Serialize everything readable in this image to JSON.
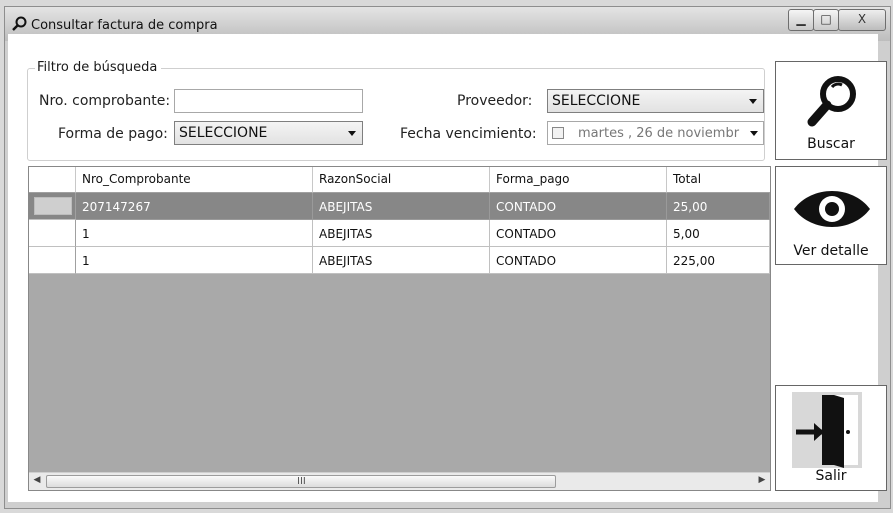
{
  "window": {
    "title": "Consultar factura de compra",
    "controls": {
      "minimize": "▁",
      "maximize": "□",
      "close": "X"
    }
  },
  "filter": {
    "legend": "Filtro de búsqueda",
    "nro_comprobante_label": "Nro. comprobante:",
    "nro_comprobante_value": "",
    "proveedor_label": "Proveedor:",
    "proveedor_value": "SELECCIONE",
    "forma_pago_label": "Forma de pago:",
    "forma_pago_value": "SELECCIONE",
    "fecha_vencimiento_label": "Fecha vencimiento:",
    "fecha_vencimiento_value": "martes   , 26 de noviembr"
  },
  "buttons": {
    "buscar": "Buscar",
    "ver_detalle": "Ver detalle",
    "salir": "Salir"
  },
  "grid": {
    "columns": [
      "Nro_Comprobante",
      "RazonSocial",
      "Forma_pago",
      "Total"
    ],
    "rows": [
      {
        "nro": "207147267",
        "razon": "ABEJITAS",
        "forma": "CONTADO",
        "total": "25,00",
        "selected": true
      },
      {
        "nro": "1",
        "razon": "ABEJITAS",
        "forma": "CONTADO",
        "total": "5,00",
        "selected": false
      },
      {
        "nro": "1",
        "razon": "ABEJITAS",
        "forma": "CONTADO",
        "total": "225,00",
        "selected": false
      }
    ],
    "scroll_grip": "III"
  },
  "icons": {
    "title": "search-icon",
    "buscar": "magnifier-icon",
    "ver_detalle": "eye-icon",
    "salir": "exit-door-icon"
  }
}
